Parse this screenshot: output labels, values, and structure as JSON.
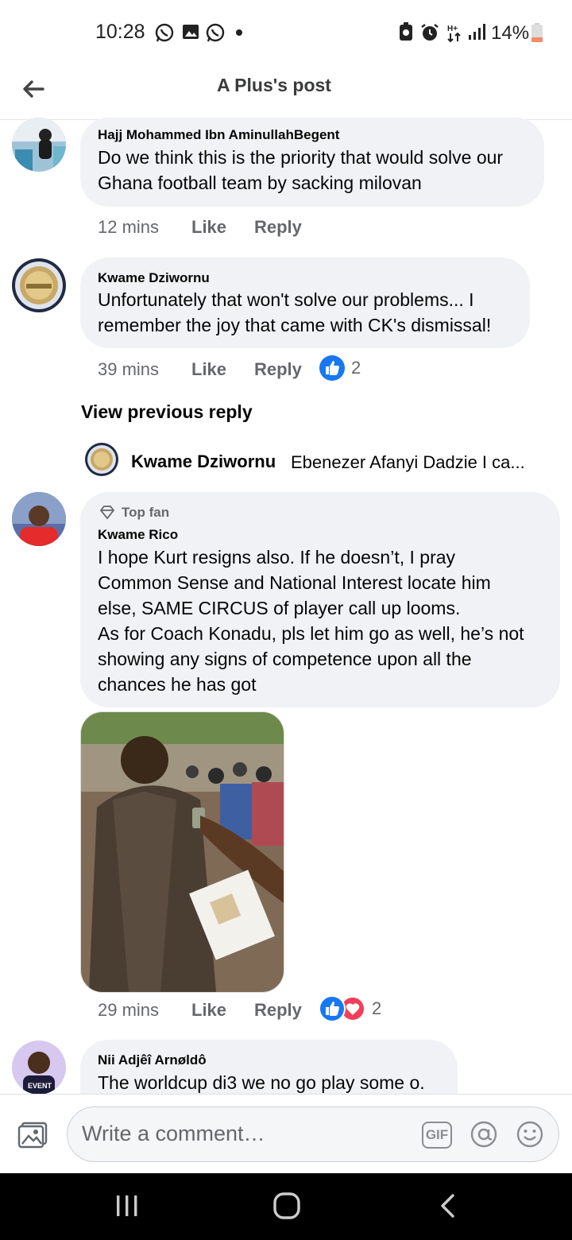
{
  "status_bar": {
    "time": "10:28",
    "battery": "14%",
    "left_icons": [
      "whatsapp-icon",
      "gallery-icon",
      "whatsapp-icon",
      "dot-icon"
    ],
    "right_icons": [
      "battery-saver-icon",
      "alarm-icon",
      "data-icon",
      "signal-icon",
      "battery-icon"
    ]
  },
  "header": {
    "title": "A Plus's post"
  },
  "comments": [
    {
      "author": "Hajj Mohammed Ibn AminullahBegent",
      "text_lines": [
        "Do we think this is the priority that would solve our",
        "Ghana football team by sacking milovan"
      ],
      "time": "12 mins",
      "like": "Like",
      "reply": "Reply"
    },
    {
      "author": "Kwame Dziwornu",
      "text_lines": [
        "Unfortunately that won't solve our problems... I",
        "remember the joy that came with CK's dismissal!"
      ],
      "time": "39 mins",
      "like": "Like",
      "reply": "Reply",
      "reactions": "2"
    },
    {
      "badge": "Top fan",
      "author": "Kwame Rico",
      "text_lines": [
        "I hope Kurt resigns also. If he doesn’t, I pray",
        "Common Sense and National Interest locate him",
        "else, SAME CIRCUS of player call up looms.",
        "As for Coach Konadu, pls let him go as well, he’s not",
        "showing any signs of competence upon all the",
        "chances he has got"
      ],
      "time": "29 mins",
      "like": "Like",
      "reply": "Reply",
      "reactions": "2"
    },
    {
      "author": "Nii Adjêî Arnøldô",
      "text_lines": [
        "The worldcup di3 we no go play some o."
      ]
    }
  ],
  "view_previous": "View previous reply",
  "reply_preview": {
    "author": "Kwame Dziwornu",
    "text": "Ebenezer Afanyi Dadzie I ca..."
  },
  "avatar_text": {
    "event": "EVENT"
  },
  "composer": {
    "placeholder": "Write a comment…",
    "gif": "GIF"
  },
  "colors": {
    "like_blue": "#1877f2",
    "love_red": "#f33e58",
    "bubble": "#f0f2f5",
    "muted": "#65676b"
  }
}
